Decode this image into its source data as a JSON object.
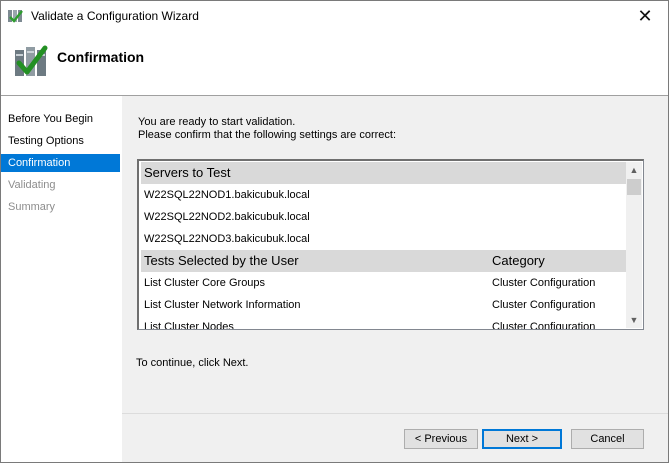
{
  "window": {
    "title": "Validate a Configuration Wizard",
    "close_glyph": "✕"
  },
  "header": {
    "title": "Confirmation"
  },
  "nav": {
    "items": [
      {
        "label": "Before You Begin",
        "state": "normal"
      },
      {
        "label": "Testing Options",
        "state": "normal"
      },
      {
        "label": "Confirmation",
        "state": "active"
      },
      {
        "label": "Validating",
        "state": "disabled"
      },
      {
        "label": "Summary",
        "state": "disabled"
      }
    ]
  },
  "content": {
    "intro_line1": "You are ready to start validation.",
    "intro_line2": "Please confirm that the following settings are correct:",
    "servers_header": "Servers to Test",
    "servers": [
      "W22SQL22NOD1.bakicubuk.local",
      "W22SQL22NOD2.bakicubuk.local",
      "W22SQL22NOD3.bakicubuk.local"
    ],
    "tests_header": "Tests Selected by the User",
    "category_header": "Category",
    "tests": [
      {
        "name": "List Cluster Core Groups",
        "category": "Cluster Configuration"
      },
      {
        "name": "List Cluster Network Information",
        "category": "Cluster Configuration"
      },
      {
        "name": "List Cluster Nodes",
        "category": "Cluster Configuration"
      }
    ],
    "continue_text": "To continue, click Next."
  },
  "buttons": {
    "previous": "< Previous",
    "next": "Next >",
    "cancel": "Cancel"
  },
  "scrollbar": {
    "up_glyph": "▲",
    "down_glyph": "▼"
  },
  "colors": {
    "accent": "#0078d7",
    "group_header_bg": "#d9d9d9",
    "content_bg": "#f0f0f0"
  }
}
